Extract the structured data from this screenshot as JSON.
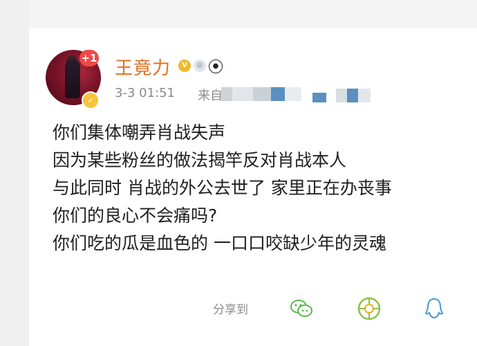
{
  "post": {
    "username": "王竟力",
    "notification_count": "+1",
    "timestamp": "3-3 01:51",
    "source_prefix": "来自",
    "lines": [
      "你们集体嘲弄肖战失声",
      "因为某些粉丝的做法揭竿反对肖战本人",
      "与此同时 肖战的外公去世了 家里正在办丧事",
      "你们的良心不会痛吗?",
      "你们吃的瓜是血色的 一口口咬缺少年的灵魂"
    ]
  },
  "share": {
    "label": "分享到",
    "targets": [
      {
        "icon": "wechat-icon",
        "color": "#5ab84a"
      },
      {
        "icon": "moments-icon",
        "color": "#7db84a"
      },
      {
        "icon": "qq-icon",
        "color": "#3f9ad6"
      }
    ]
  },
  "colors": {
    "username": "#e36d1f",
    "badge": "#f04848",
    "verified": "#f6c33a"
  }
}
